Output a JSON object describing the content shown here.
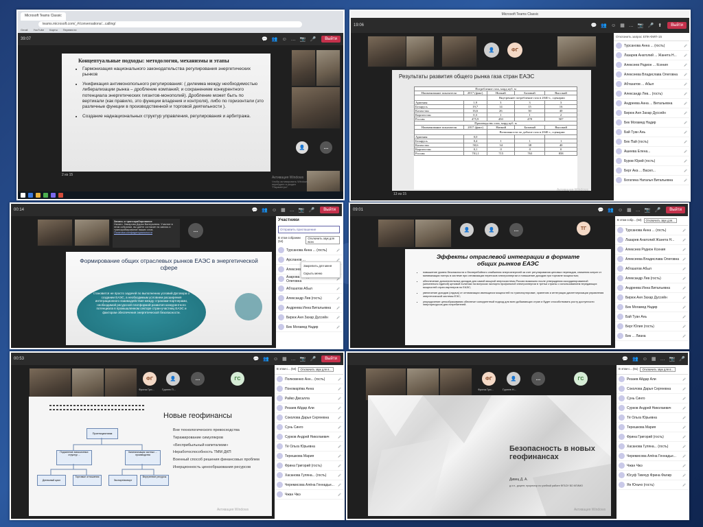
{
  "shot1": {
    "tab_label": "Microsoft Teams Classic",
    "url": "teams.microsoft.com/_#/conversations/...calling/",
    "bookmarks": [
      "Gmail",
      "YouTube",
      "Карты",
      "Перевести"
    ],
    "slide_title": "Концептуальные подходы: методология, механизмы и этапы",
    "bullets": [
      "Гармонизация национального законодательства регулирования энергетических рынков",
      "Унификация антимонопольного регулирования: ( дилемма между необходимостью либерализации рынка – дробление компаний; и сохранением конкурентного потенциала энергетических гигантов-монополий). Дробление может быть по вертикали (как правило, это функции владения и контроля), либо по горизонтали (это различные функции в производственной и торговой деятельности ).",
      "Создание наднациональных структур управления, регулирования и арбитража."
    ],
    "timer": "39:07",
    "leave": "Выйти",
    "page_indicator": "2 из 15",
    "watermark": "Активация Windows",
    "watermark_sub": "Чтобы активировать Windows, перейдите в раздел \"Параметры\"."
  },
  "shot2": {
    "window_title": "Microsoft Teams Classic",
    "timer": "19:06",
    "leave": "Выйти",
    "avatar_initials": "ФГ",
    "slide_title": "Результаты развития общего рынка газа стран ЕАЭС",
    "table1_caption": "Потребление газа, млрд куб. м",
    "table1_headers": [
      "Наименование показателя",
      "2017 (факт)",
      "Низкий",
      "Базовый",
      "Высокий"
    ],
    "table1_subcaption": "Внутреннее потребление газа в 2040 г., сценарии",
    "table1_rows": [
      [
        "Армения",
        "1,9",
        "3",
        "3",
        "3"
      ],
      [
        "Беларусь",
        "19,7",
        "14",
        "15",
        "16"
      ],
      [
        "Казахстан",
        "16,6",
        "26",
        "30",
        "40"
      ],
      [
        "Киргизстан",
        "0,3",
        "1",
        "1",
        "2"
      ],
      [
        "Россия",
        "475,9",
        "450",
        "478",
        "507"
      ]
    ],
    "table2_caption": "Производство газа, млрд куб. м",
    "table2_subcaption": "Возможности по добыче газа в 2040 г., сценарии",
    "table2_rows": [
      [
        "Армения",
        "0,0",
        "",
        "",
        ""
      ],
      [
        "Беларусь",
        "0,4",
        "1",
        "1",
        "1"
      ],
      [
        "Казахстан",
        "50,6",
        "34",
        "38",
        "40"
      ],
      [
        "Киргизстан",
        "0,1",
        "0",
        "0",
        "0"
      ],
      [
        "Россия",
        "701,1",
        "715",
        "763",
        "858"
      ]
    ],
    "page_indicator": "13 из 15",
    "panel_header": "Отклонить запрос ЕПК-ФИП-15",
    "participants": [
      "Турсанова Анна ... (гость)",
      "Лазарев Анатолий ... Жанета Н...",
      "Алексеев Родион ... Ксения",
      "Алексеева Владислава Олеговна",
      "Абтазатов ... Абыл",
      "Александр Лев... (гость)",
      "Андреева Анна ... Витальевна",
      "Бирюк Аня Захар Дуссейн",
      "Бек Могамед Надир",
      "Бай Туан Ань",
      "Бек Пай (гость)",
      "Ашеева Елена...",
      "Буров Юрий (гость)",
      "Берг Ака ... Васил...",
      "Богатина Наталья Витальевна"
    ],
    "watermark": "Активация Windows",
    "watermark_sub": "Чтобы активировать Windows, перейдите в раздел \"Параметры\"."
  },
  "shot3": {
    "timer": "00:14",
    "leave": "Выйти",
    "notification_title": "Запись и транскрибирование",
    "notification_text": "Начато. Накарова Дарья Валерьевна. Участие в этом собрании, вы даёте согласие на запись и транскрибирование ваших слов.",
    "notification_link": "Политика конфиденциальности",
    "slide_title": "Формирование общих отраслевых рынков ЕАЭС в энергетической сфере",
    "slide_body": "становится не просто задачей по выполнению условий Договора о создании ЕАЭС, а необходимым условием расширения интеграционного взаимодействия между странами-партнерами, необходимой ресурсной платформой развития конкурентного потенциала в промышленном секторе стран-участниц ЕАЭС и фактором обеспечения энергетической безопасности.",
    "panel_title": "Участники",
    "invite_button": "Отправить приглашение",
    "in_meeting_label": "В этом собрании (54)",
    "mute_all": "Отключить звук для всех",
    "menu_items": [
      "Закрепить для меня",
      "Скрыть меню"
    ],
    "participants": [
      "Турсанова Анна ... (гость)",
      "Арсланов ...",
      "Алексеев ...",
      "Азарова Владислава Олеговна",
      "Абтазатов Абыл",
      "Александр Лев (гость)",
      "Андреева Инна Витальевна",
      "Бирюк Аня Захар Дуссейн",
      "Бек Могамед Надир"
    ]
  },
  "shot4": {
    "timer": "09:01",
    "leave": "Выйти",
    "avatar_initials": "ТГ",
    "slide_title": "Эффекты отраслевой интеграции в формате общих рынков ЕАЭС",
    "bullets": [
      "повышение уровня безопасности и бесперебойного снабжения энергоэнергией за счет регулирования ценовых перепадов, снижения затрат от минимизации потерь в системе при оптимизации перетоков электроэнергии и повышение доходов при торговле мощностью;",
      "обеспечение дополнительных доходов для самой мощной энергосистемы России возможно после утверждения скоординированной (желательно единой) ценовой политики на вопросах экспорта профильной электроэнергии в третьи страны с использованием передающих мощностей стран-партнеров по ЕАЭС;",
      "увеличение доходов (отдача) от оптимизации имеющихся мощностей по транспортировке, хранению и интеграции диспетчеризации управления энергетической системы ЕЭС;",
      "упорядочение ценообразования обеспечит конкурентный подход для всех добывающих стран и будет способствовать росту доступности энергоресурсов для потребителей."
    ],
    "panel_header": "Отключить звук для...",
    "in_meeting_label": "В этом собр... (53)",
    "participants": [
      "Турсанова Анна ... (гость)",
      "Лазарев Анатолий Жанета Н...",
      "Алексеев Родион Ксения",
      "Алексеева Владислава Олеговна",
      "Абтазатов Абыл",
      "Александр Лев (гость)",
      "Андреева Инна Витальевна",
      "Бирюк Аня Захар Дуссейн",
      "Бек Могамед Надир",
      "Бай Туан Ань",
      "Берг Юлия (гость)",
      "Бек ... Лиана"
    ]
  },
  "shot5": {
    "timer": "00:53",
    "leave": "Выйти",
    "avatar1_initials": "ФГ",
    "avatar1_name": "Фрина Гри...",
    "avatar2_name": "Гуреев П...",
    "avatar3_initials": "ГС",
    "slide_title": "Новые геофинансы",
    "diagram_top": "Протекционизм",
    "diagram_nodes": [
      "Подчинение эмиссионных структур ... ",
      "Капитализация частных ... производства",
      "Денежный цикл",
      "Торговые отношения",
      "Экспорт/импорт",
      "Внутренние ресурсы"
    ],
    "list_items": [
      "Вне технологического превосходства",
      "Тиражирование симулякров",
      "«Бесприбыльный капитализм»",
      "Неработоспособность ТММ ДКП",
      "Военный способ решения финансовых проблем",
      "Инерционность ценообразования ресурсов"
    ],
    "in_meeting_label": "В этом с... (54)",
    "panel_header": "Отключить звук для в...",
    "participants": [
      "Полковенко Анн... (гость)",
      "Пономарёва Анна",
      "Райко Дмсалла",
      "Резаев Айдар Али",
      "Соколова Дарья Сергеевна",
      "Сунь Синго",
      "Сурков Андрей Николаевич",
      "Тё Ольга Юрьевна",
      "Терешкова Мария",
      "Фрина Григорий (гость)",
      "Хасанова Гуляна... (гость)",
      "Черемисова Алёна Геннадье...",
      "Чжан Чжэ"
    ],
    "watermark": "Активация Windows"
  },
  "shot6": {
    "avatar1_initials": "ФГ",
    "avatar1_name": "Фрина Гри...",
    "avatar2_name": "Гуреев Н...",
    "avatar3_initials": "ГС",
    "slide_title": "Безопасность в новых геофинансах",
    "author": "Дивец Д. А.",
    "author_desc": "д.э.н., доцент, проректор по учебной работе ФГБОУ ВО МГИМО",
    "in_meeting_label": "В этом с... (51)",
    "panel_header": "Отключить звук для в...",
    "participants": [
      "Резаев Айдар Али",
      "Соколова Дарья Сергеевна",
      "Сунь Синго",
      "Сурков Андрей Николаевич",
      "Тё Ольга Юрьевна",
      "Терешкова Мария",
      "Фрина Григорий (гость)",
      "Хасанова Гуляна... (гость)",
      "Черемисова Алёна Геннадье...",
      "Чжан Чжэ",
      "Юсуф Тимчур Фрина Фалир",
      "Ян Юньчо (гость)"
    ],
    "watermark": "Активация Windows"
  }
}
